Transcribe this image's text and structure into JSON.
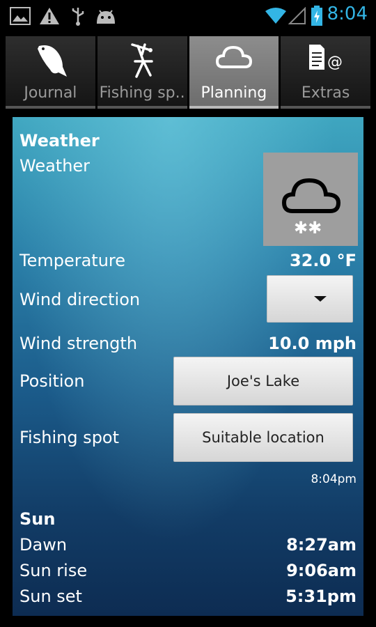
{
  "statusbar": {
    "time": "8:04",
    "icons": [
      "image-icon",
      "warning-icon",
      "usb-icon",
      "android-icon",
      "wifi-icon",
      "signal-icon",
      "battery-icon"
    ]
  },
  "tabs": [
    {
      "label": "Journal",
      "icon": "fish-icon",
      "active": false
    },
    {
      "label": "Fishing sp..",
      "icon": "fishing-spot-icon",
      "active": false
    },
    {
      "label": "Planning",
      "icon": "cloud-icon",
      "active": true
    },
    {
      "label": "Extras",
      "icon": "document-at-icon",
      "active": false
    }
  ],
  "weather": {
    "section_title": "Weather",
    "label": "Weather",
    "icon": "cloud-snow-icon",
    "temperature_label": "Temperature",
    "temperature_value": "32.0 °F",
    "wind_direction_label": "Wind direction",
    "wind_strength_label": "Wind strength",
    "wind_strength_value": "10.0 mph",
    "position_label": "Position",
    "position_button": "Joe's Lake",
    "fishing_spot_label": "Fishing spot",
    "fishing_spot_button": "Suitable location",
    "timestamp": "8:04pm"
  },
  "sun": {
    "section_title": "Sun",
    "dawn_label": "Dawn",
    "dawn_value": "8:27am",
    "sunrise_label": "Sun rise",
    "sunrise_value": "9:06am",
    "sunset_label": "Sun set",
    "sunset_value": "5:31pm"
  },
  "colors": {
    "accent": "#33b5e5",
    "active_tab": "#7d7d7d",
    "panel_top": "#3fa6c0",
    "panel_bottom": "#0d2c52"
  }
}
